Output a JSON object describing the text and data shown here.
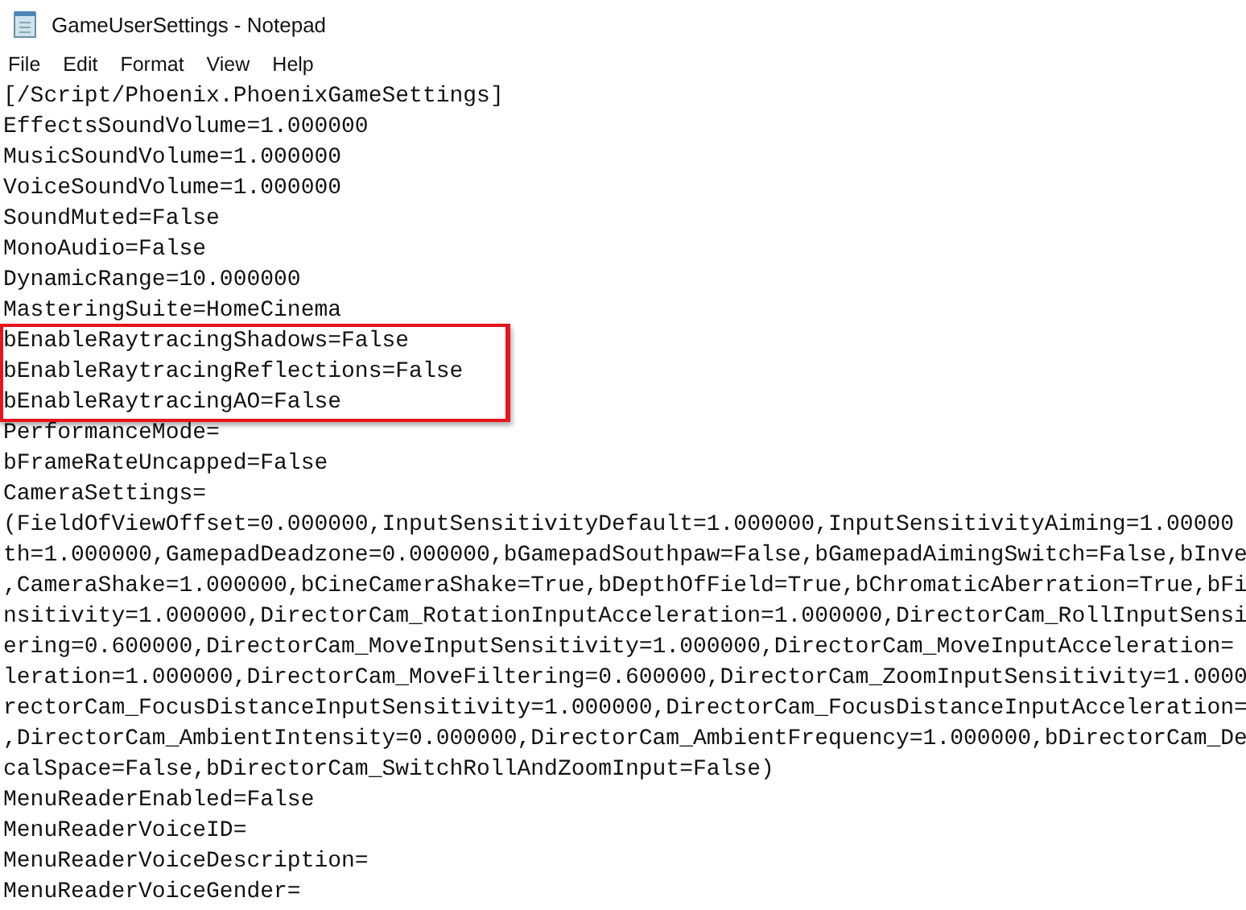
{
  "window": {
    "title": "GameUserSettings - Notepad"
  },
  "menu": [
    "File",
    "Edit",
    "Format",
    "View",
    "Help"
  ],
  "lines_before": [
    "[/Script/Phoenix.PhoenixGameSettings]",
    "EffectsSoundVolume=1.000000",
    "MusicSoundVolume=1.000000",
    "VoiceSoundVolume=1.000000",
    "SoundMuted=False",
    "MonoAudio=False",
    "DynamicRange=10.000000",
    "MasteringSuite=HomeCinema"
  ],
  "highlight_box": {
    "lines": [
      "bEnableRaytracingShadows=False",
      "bEnableRaytracingReflections=False",
      "bEnableRaytracingAO=False"
    ]
  },
  "lines_after": [
    "PerformanceMode=",
    "bFrameRateUncapped=False",
    "CameraSettings=",
    "(FieldOfViewOffset=0.000000,InputSensitivityDefault=1.000000,InputSensitivityAiming=1.00000",
    "th=1.000000,GamepadDeadzone=0.000000,bGamepadSouthpaw=False,bGamepadAimingSwitch=False,bInve",
    ",CameraShake=1.000000,bCineCameraShake=True,bDepthOfField=True,bChromaticAberration=True,bFi",
    "nsitivity=1.000000,DirectorCam_RotationInputAcceleration=1.000000,DirectorCam_RollInputSensi",
    "ering=0.600000,DirectorCam_MoveInputSensitivity=1.000000,DirectorCam_MoveInputAcceleration=",
    "leration=1.000000,DirectorCam_MoveFiltering=0.600000,DirectorCam_ZoomInputSensitivity=1.0000",
    "rectorCam_FocusDistanceInputSensitivity=1.000000,DirectorCam_FocusDistanceInputAcceleration=",
    ",DirectorCam_AmbientIntensity=0.000000,DirectorCam_AmbientFrequency=1.000000,bDirectorCam_De",
    "calSpace=False,bDirectorCam_SwitchRollAndZoomInput=False)",
    "MenuReaderEnabled=False",
    "MenuReaderVoiceID=",
    "MenuReaderVoiceDescription=",
    "MenuReaderVoiceGender="
  ]
}
